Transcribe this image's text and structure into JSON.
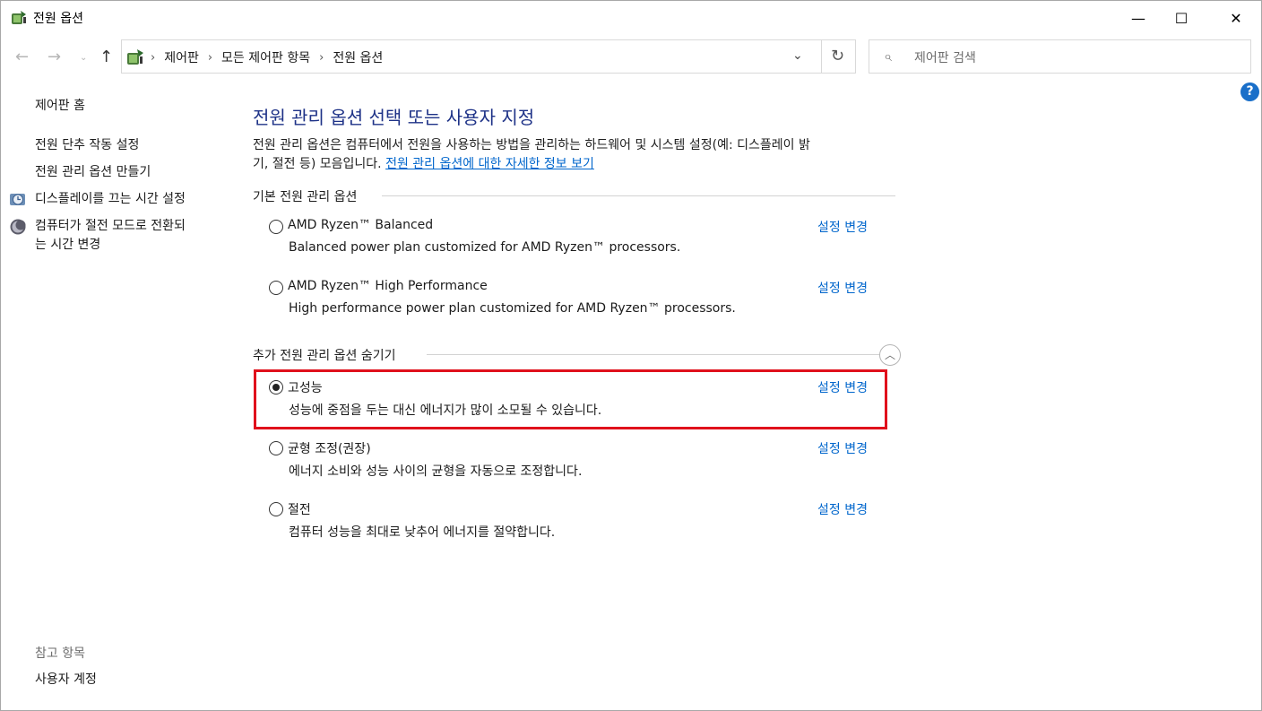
{
  "window": {
    "title": "전원 옵션"
  },
  "window_controls": {
    "minimize": "—",
    "maximize": "☐",
    "close": "✕"
  },
  "nav": {
    "back_glyph": "←",
    "forward_glyph": "→",
    "recent_glyph": "⌄",
    "up_glyph": "↑",
    "breadcrumbs": [
      "제어판",
      "모든 제어판 항목",
      "전원 옵션"
    ],
    "crumb_sep": "›",
    "dropdown_glyph": "⌄",
    "refresh_glyph": "↻"
  },
  "search": {
    "placeholder": "제어판 검색",
    "icon_glyph": "⌕"
  },
  "help": {
    "glyph": "?"
  },
  "sidebar": {
    "home": "제어판 홈",
    "links": [
      "전원 단추 작동 설정",
      "전원 관리 옵션 만들기",
      "디스플레이를 끄는 시간 설정",
      "컴퓨터가 절전 모드로 전환되",
      "는 시간 변경"
    ],
    "see_also_header": "참고 항목",
    "see_also": [
      "사용자 계정"
    ]
  },
  "main": {
    "title": "전원 관리 옵션 선택 또는 사용자 지정",
    "desc_line1": "전원 관리 옵션은 컴퓨터에서 전원을 사용하는 방법을 관리하는 하드웨어 및 시스템 설정(예: 디스플레이 밝",
    "desc_line2": "기, 절전 등) 모음입니다.",
    "desc_link": "전원 관리 옵션에 대한 자세한 정보 보기",
    "group_basic": "기본 전원 관리 옵션",
    "group_extra": "추가 전원 관리 옵션 숨기기",
    "collapse_glyph": "︿",
    "plans": [
      {
        "name": "AMD Ryzen™ Balanced",
        "desc": "Balanced power plan customized for AMD Ryzen™ processors.",
        "link": "설정 변경",
        "selected": false
      },
      {
        "name": "AMD Ryzen™ High Performance",
        "desc": "High performance power plan customized for AMD Ryzen™ processors.",
        "link": "설정 변경",
        "selected": false
      },
      {
        "name": "고성능",
        "desc": "성능에 중점을 두는 대신 에너지가 많이 소모될 수 있습니다.",
        "link": "설정 변경",
        "selected": true
      },
      {
        "name": "균형 조정(권장)",
        "desc": "에너지 소비와 성능 사이의 균형을 자동으로 조정합니다.",
        "link": "설정 변경",
        "selected": false
      },
      {
        "name": "절전",
        "desc": "컴퓨터 성능을 최대로 낮추어 에너지를 절약합니다.",
        "link": "설정 변경",
        "selected": false
      }
    ]
  },
  "colors": {
    "link": "#0066cc",
    "title": "#1e3287",
    "highlight": "#e0101c"
  }
}
